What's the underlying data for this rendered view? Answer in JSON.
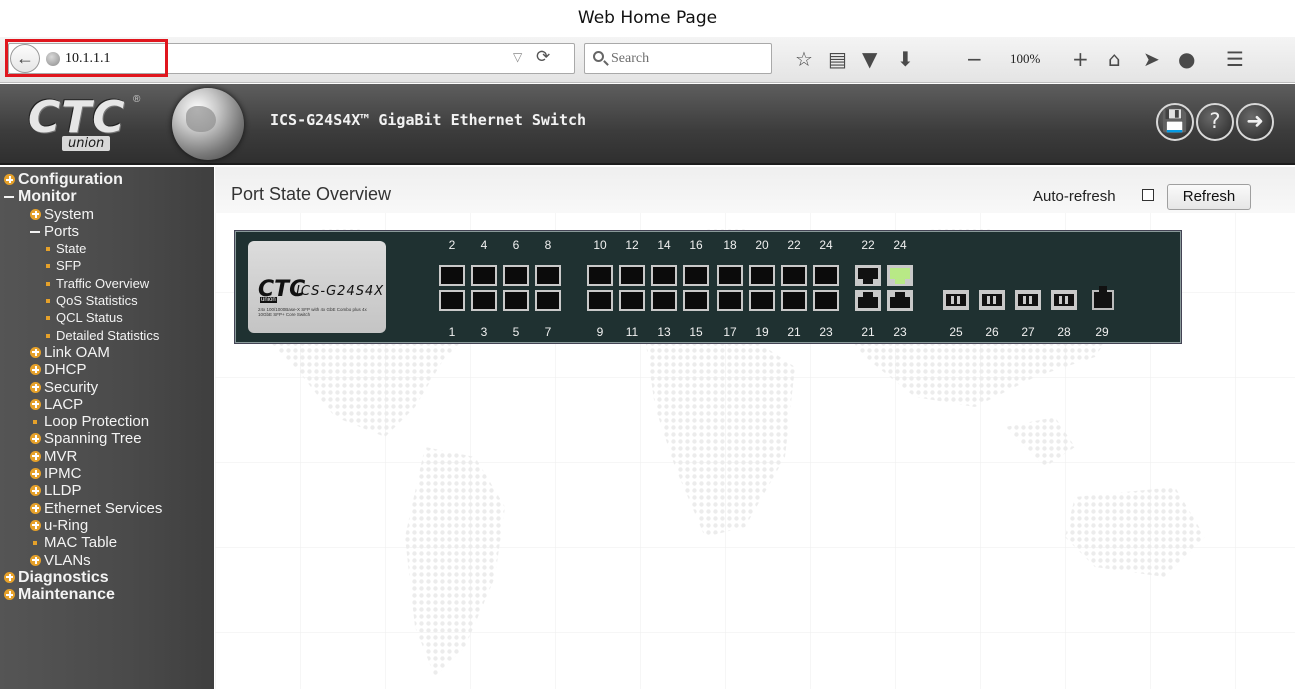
{
  "caption": "Web Home Page",
  "browser": {
    "url": "10.1.1.1",
    "search_placeholder": "Search",
    "zoom": "100%"
  },
  "header": {
    "logo_text": "CTC",
    "logo_sub": "union",
    "title": "ICS-G24S4X™ GigaBit Ethernet Switch"
  },
  "nav": {
    "items": [
      {
        "label": "Configuration",
        "level": 0,
        "marker": "plus"
      },
      {
        "label": "Monitor",
        "level": 0,
        "marker": "minus"
      },
      {
        "label": "System",
        "level": 1,
        "marker": "plus"
      },
      {
        "label": "Ports",
        "level": 1,
        "marker": "minus"
      },
      {
        "label": "State",
        "level": 2,
        "marker": "dot"
      },
      {
        "label": "SFP",
        "level": 2,
        "marker": "dot"
      },
      {
        "label": "Traffic Overview",
        "level": 2,
        "marker": "dot"
      },
      {
        "label": "QoS Statistics",
        "level": 2,
        "marker": "dot"
      },
      {
        "label": "QCL Status",
        "level": 2,
        "marker": "dot"
      },
      {
        "label": "Detailed Statistics",
        "level": 2,
        "marker": "dot"
      },
      {
        "label": "Link OAM",
        "level": 1,
        "marker": "plus"
      },
      {
        "label": "DHCP",
        "level": 1,
        "marker": "plus"
      },
      {
        "label": "Security",
        "level": 1,
        "marker": "plus"
      },
      {
        "label": "LACP",
        "level": 1,
        "marker": "plus"
      },
      {
        "label": "Loop Protection",
        "level": 1,
        "marker": "dot"
      },
      {
        "label": "Spanning Tree",
        "level": 1,
        "marker": "plus"
      },
      {
        "label": "MVR",
        "level": 1,
        "marker": "plus"
      },
      {
        "label": "IPMC",
        "level": 1,
        "marker": "plus"
      },
      {
        "label": "LLDP",
        "level": 1,
        "marker": "plus"
      },
      {
        "label": "Ethernet Services",
        "level": 1,
        "marker": "plus"
      },
      {
        "label": "u-Ring",
        "level": 1,
        "marker": "plus"
      },
      {
        "label": "MAC Table",
        "level": 1,
        "marker": "dot"
      },
      {
        "label": "VLANs",
        "level": 1,
        "marker": "plus"
      },
      {
        "label": "Diagnostics",
        "level": 0,
        "marker": "plus"
      },
      {
        "label": "Maintenance",
        "level": 0,
        "marker": "plus"
      }
    ]
  },
  "main": {
    "title": "Port State Overview",
    "auto_refresh_label": "Auto-refresh",
    "auto_refresh_checked": false,
    "refresh_label": "Refresh"
  },
  "switch_panel": {
    "model_logo": "CTC",
    "model_logo_sub": "union",
    "model_name": "ICS-G24S4X",
    "model_desc": "24x 100/1000Base-X SFP with 4x GbE Combo plus 4x 10GbE SFP+ Core Switch",
    "top_labels": [
      "2",
      "4",
      "6",
      "8",
      "10",
      "12",
      "14",
      "16",
      "18",
      "20",
      "22",
      "24",
      "22",
      "24"
    ],
    "bottom_labels": [
      "1",
      "3",
      "5",
      "7",
      "9",
      "11",
      "13",
      "15",
      "17",
      "19",
      "21",
      "23",
      "21",
      "23",
      "25",
      "26",
      "27",
      "28",
      "29"
    ],
    "combo_link_up": [
      "24"
    ]
  }
}
